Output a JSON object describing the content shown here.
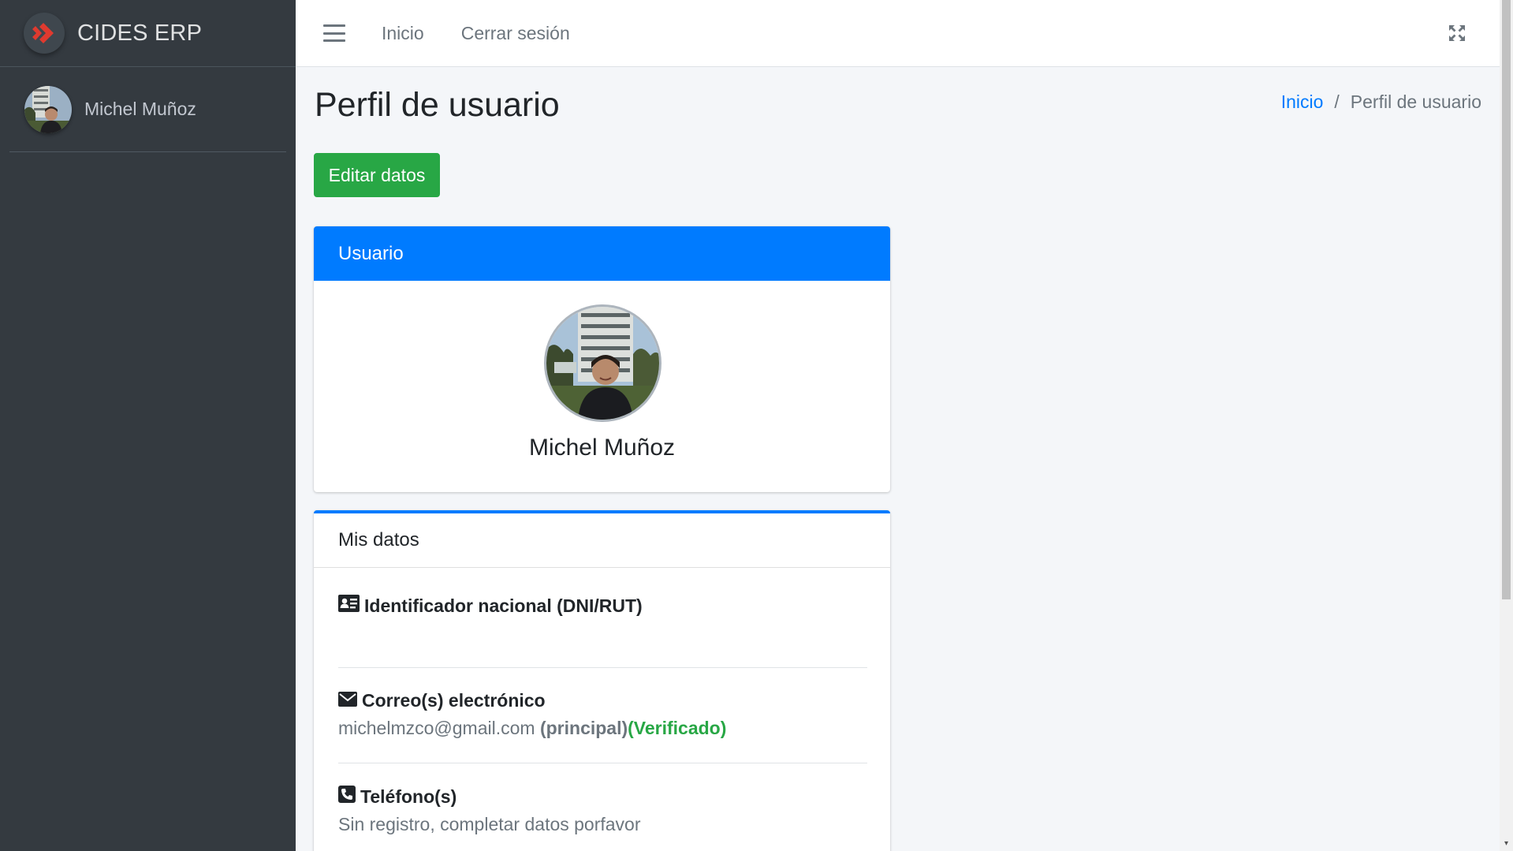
{
  "brand": {
    "name": "CIDES ERP"
  },
  "sidebar": {
    "user_name": "Michel Muñoz"
  },
  "topbar": {
    "links": [
      {
        "label": "Inicio"
      },
      {
        "label": "Cerrar sesión"
      }
    ]
  },
  "page": {
    "title": "Perfil de usuario",
    "breadcrumb": {
      "home": "Inicio",
      "separator": "/",
      "current": "Perfil de usuario"
    },
    "edit_button": "Editar datos"
  },
  "user_card": {
    "header": "Usuario",
    "name": "Michel Muñoz"
  },
  "data_card": {
    "header": "Mis datos",
    "national_id": {
      "label": "Identificador nacional (DNI/RUT)",
      "value": ""
    },
    "email": {
      "label": "Correo(s) electrónico",
      "value": "michelmzco@gmail.com",
      "primary_tag": "(principal)",
      "verified_tag": "(Verificado)"
    },
    "phone": {
      "label": "Teléfono(s)",
      "value": "Sin registro, completar datos porfavor"
    }
  },
  "colors": {
    "sidebar_bg": "#343a40",
    "primary": "#007bff",
    "success": "#28a745",
    "brand_logo": "#e03a2f"
  }
}
